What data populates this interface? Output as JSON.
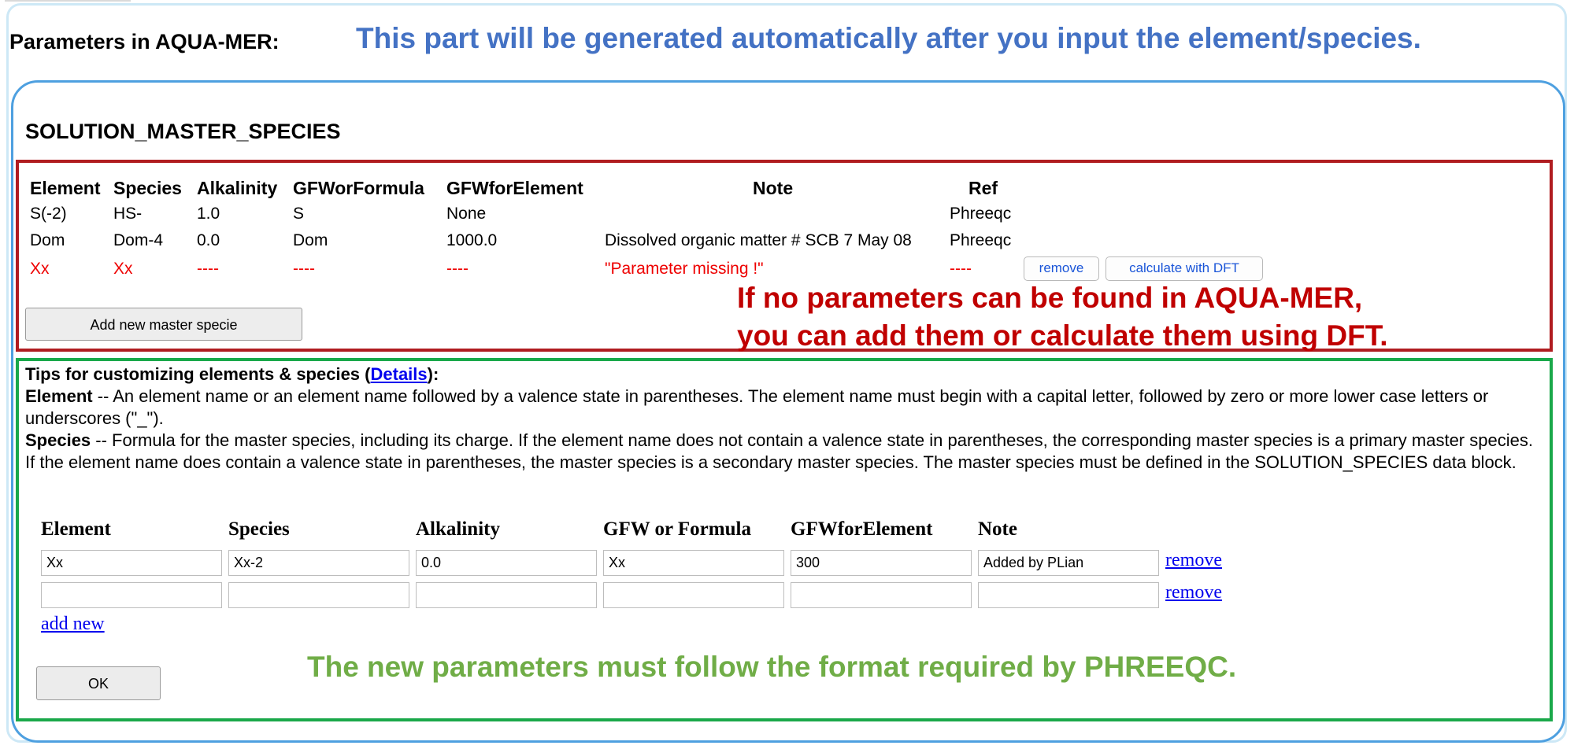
{
  "header": {
    "section_label": "Parameters in AQUA-MER:",
    "banner": "This part will be generated automatically after you input the element/species."
  },
  "master_block": {
    "title": "SOLUTION_MASTER_SPECIES",
    "columns": [
      "Element",
      "Species",
      "Alkalinity",
      "GFWorFormula",
      "GFWforElement",
      "Note",
      "Ref"
    ],
    "rows": [
      [
        "S(-2)",
        "HS-",
        "1.0",
        "S",
        "None",
        "",
        "Phreeqc"
      ],
      [
        "Dom",
        "Dom-4",
        "0.0",
        "Dom",
        "1000.0",
        "Dissolved organic matter # SCB 7 May 08",
        "Phreeqc"
      ],
      [
        "Xx",
        "Xx",
        "----",
        "----",
        "----",
        "\"Parameter missing !\"",
        "----"
      ]
    ],
    "remove_label": "remove",
    "calculate_label": "calculate with DFT",
    "add_button": "Add new master specie",
    "annotation_line1": "If no parameters can be found in AQUA-MER,",
    "annotation_line2": "you can add them or calculate them using DFT."
  },
  "tips": {
    "heading": "Tips for customizing elements & species (",
    "details_link": "Details",
    "heading_end": "):",
    "element_term": "Element",
    "element_text": " -- An element name or an element name followed by a valence state in parentheses. The element name must begin with a capital letter, followed by zero or more lower case letters or underscores (\"_\").",
    "species_term": "Species",
    "species_text": " -- Formula for the master species, including its charge. If the element name does not contain a valence state in parentheses, the corresponding master species is a primary master species. If the element name does contain a valence state in parentheses, the master species is a secondary master species. The master species must be defined in the SOLUTION_SPECIES data block."
  },
  "form": {
    "headers": [
      "Element",
      "Species",
      "Alkalinity",
      "GFW or Formula",
      "GFWforElement",
      "Note"
    ],
    "row1": [
      "Xx",
      "Xx-2",
      "0.0",
      "Xx",
      "300",
      "Added by PLian"
    ],
    "row2": [
      "",
      "",
      "",
      "",
      "",
      ""
    ],
    "remove_label": "remove",
    "add_new": "add new",
    "ok": "OK"
  },
  "green_note": "The new parameters must follow the format required by PHREEQC.",
  "colors": {
    "banner": "#4472c4",
    "red_box": "#b01c20",
    "missing": "#ee0000",
    "green_box": "#1aa84a",
    "green_note": "#70ad47",
    "frame": "#4ea0e0"
  }
}
